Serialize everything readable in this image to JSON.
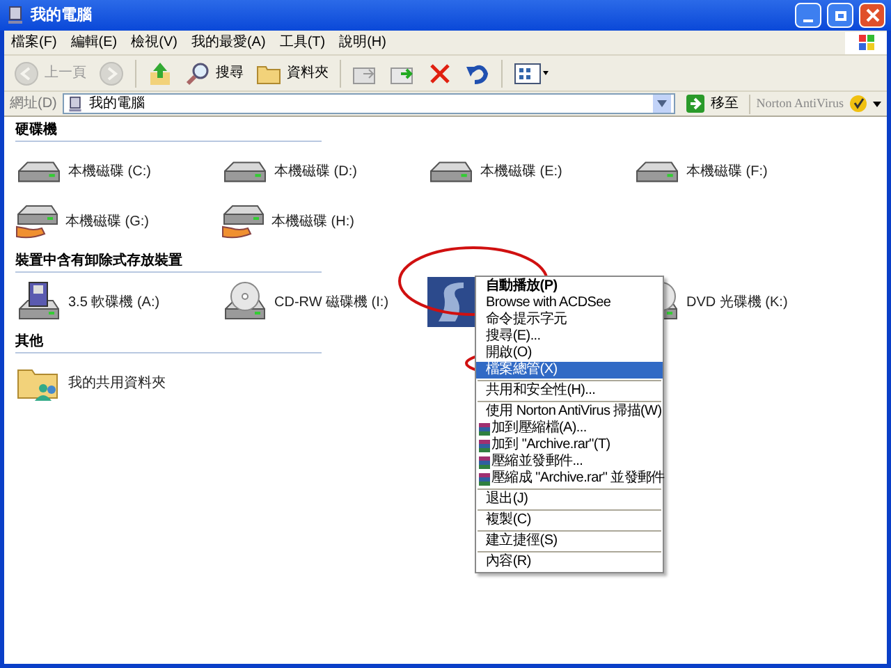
{
  "window": {
    "title": "我的電腦"
  },
  "menu_bar": [
    "檔案(F)",
    "編輯(E)",
    "檢視(V)",
    "我的最愛(A)",
    "工具(T)",
    "說明(H)"
  ],
  "toolbar": [
    {
      "kind": "back",
      "label": "上一頁",
      "disabled": true
    },
    {
      "kind": "forward",
      "disabled": true
    },
    {
      "kind": "up"
    },
    {
      "kind": "search",
      "label": "搜尋"
    },
    {
      "kind": "folders",
      "label": "資料夾"
    },
    {
      "kind": "move"
    },
    {
      "kind": "copy"
    },
    {
      "kind": "delete"
    },
    {
      "kind": "undo"
    },
    {
      "kind": "views"
    }
  ],
  "address_bar": {
    "label": "網址(D)",
    "value": "我的電腦",
    "go": "移至",
    "norton": "Norton AntiVirus"
  },
  "sections": [
    {
      "title": "硬碟機",
      "items": [
        {
          "kind": "hdd",
          "label": "本機磁碟 (C:)"
        },
        {
          "kind": "hdd",
          "label": "本機磁碟 (D:)"
        },
        {
          "kind": "hdd",
          "label": "本機磁碟 (E:)"
        },
        {
          "kind": "hdd",
          "label": "本機磁碟 (F:)"
        },
        {
          "kind": "shared-hdd",
          "label": "本機磁碟 (G:)"
        },
        {
          "kind": "shared-hdd",
          "label": "本機磁碟 (H:)"
        }
      ]
    },
    {
      "title": "裝置中含有卸除式存放裝置",
      "items": [
        {
          "kind": "floppy",
          "label": "3.5 軟碟機 (A:)"
        },
        {
          "kind": "cdrom",
          "label": "CD-RW 磁碟機 (I:)"
        },
        {
          "kind": "acdsee"
        },
        {
          "kind": "dvd",
          "label": "DVD 光碟機 (K:)"
        }
      ]
    },
    {
      "title": "其他",
      "items": [
        {
          "kind": "shared-folder",
          "label": "我的共用資料夾"
        }
      ]
    }
  ],
  "context_menu": [
    {
      "kind": "item",
      "label": "自動播放(P)",
      "bold": true,
      "selected": false
    },
    {
      "kind": "item",
      "label": "Browse with ACDSee",
      "bold": false,
      "selected": false
    },
    {
      "kind": "item",
      "label": "命令提示字元",
      "bold": false,
      "selected": false
    },
    {
      "kind": "item",
      "label": "搜尋(E)...",
      "bold": false,
      "selected": false
    },
    {
      "kind": "item",
      "label": "開啟(O)",
      "bold": false,
      "selected": false
    },
    {
      "kind": "item",
      "label": "檔案總管(X)",
      "bold": false,
      "selected": true
    },
    {
      "kind": "separator"
    },
    {
      "kind": "item",
      "label": "共用和安全性(H)...",
      "bold": false,
      "selected": false
    },
    {
      "kind": "separator"
    },
    {
      "kind": "item",
      "label": "使用 Norton AntiVirus 掃描(W)",
      "bold": false,
      "selected": false
    },
    {
      "kind": "rar-item",
      "label": "加到壓縮檔(A)...",
      "bold": false,
      "selected": false
    },
    {
      "kind": "rar-item",
      "label": "加到 \"Archive.rar\"(T)",
      "bold": false,
      "selected": false
    },
    {
      "kind": "rar-item",
      "label": "壓縮並發郵件...",
      "bold": false,
      "selected": false
    },
    {
      "kind": "rar-item",
      "label": "壓縮成 \"Archive.rar\" 並發郵件",
      "bold": false,
      "selected": false
    },
    {
      "kind": "separator"
    },
    {
      "kind": "item",
      "label": "退出(J)",
      "bold": false,
      "selected": false
    },
    {
      "kind": "separator"
    },
    {
      "kind": "item",
      "label": "複製(C)",
      "bold": false,
      "selected": false
    },
    {
      "kind": "separator"
    },
    {
      "kind": "item",
      "label": "建立捷徑(S)",
      "bold": false,
      "selected": false
    },
    {
      "kind": "separator"
    },
    {
      "kind": "item",
      "label": "內容(R)",
      "bold": false,
      "selected": false
    }
  ]
}
